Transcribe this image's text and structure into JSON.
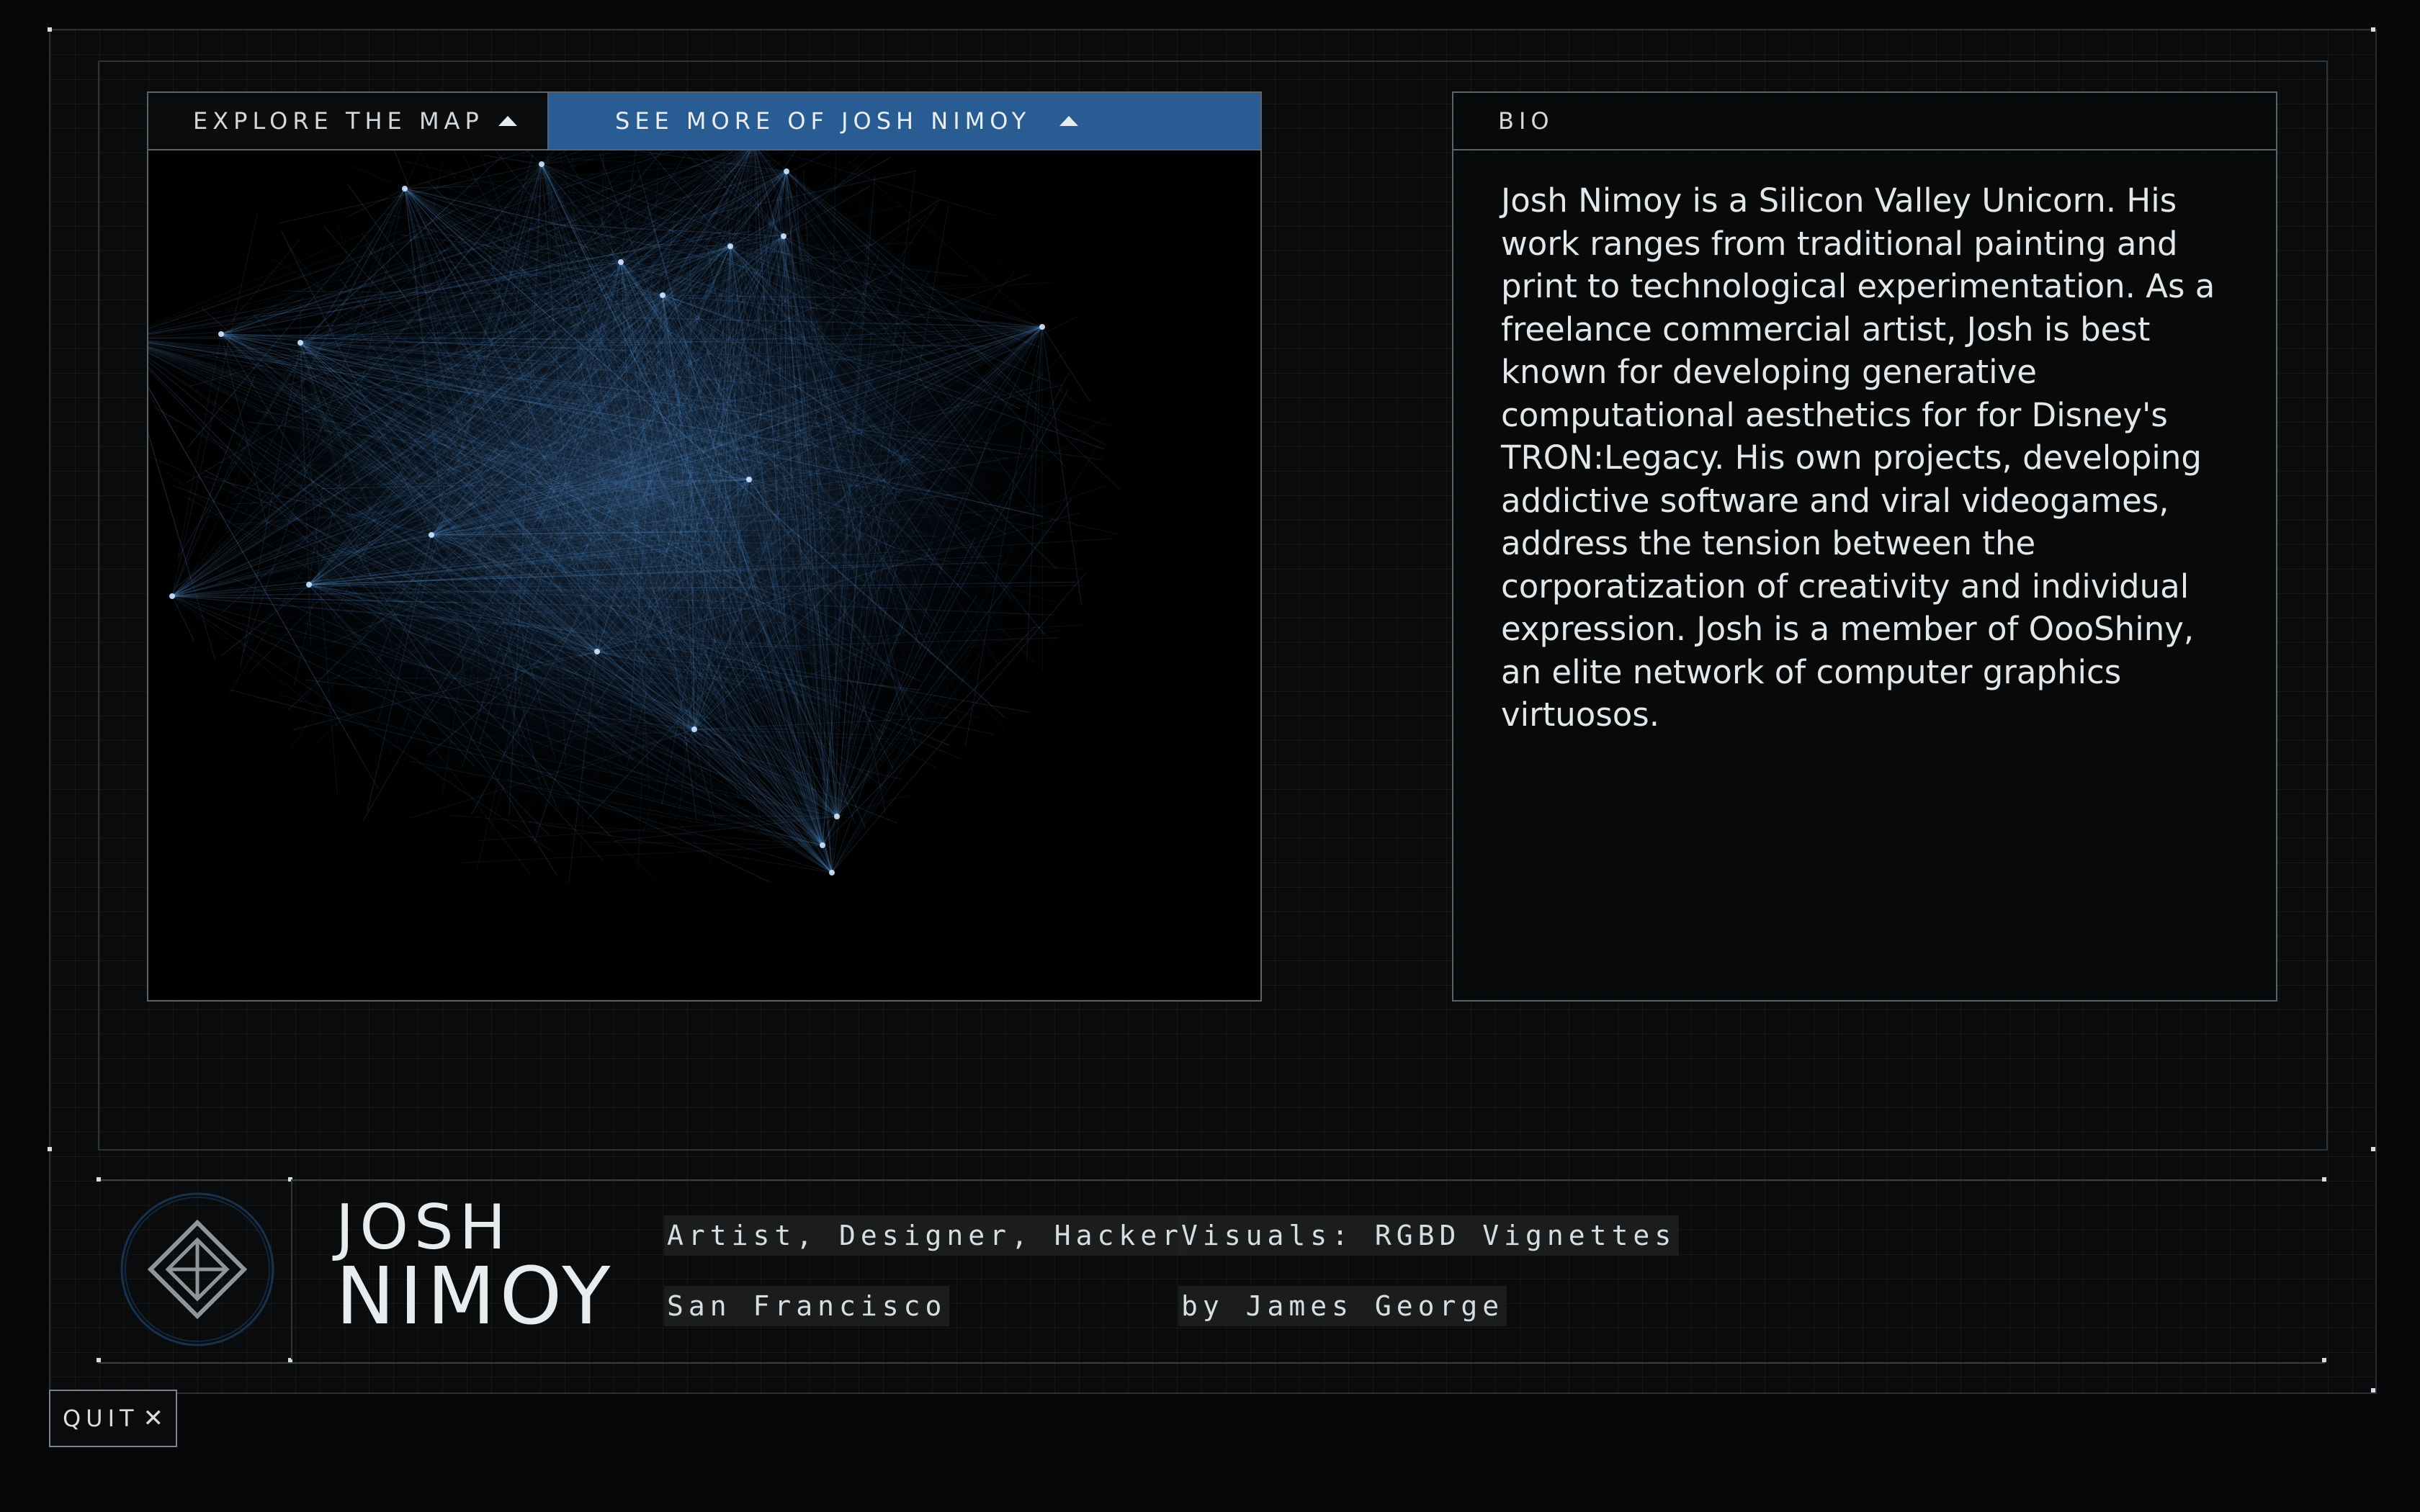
{
  "tabs": {
    "explore_label": "EXPLORE THE MAP",
    "see_more_label": "SEE MORE OF JOSH NIMOY"
  },
  "bio": {
    "header": "BIO",
    "lines": [
      "Josh Nimoy is a Silicon Valley Unicorn. His",
      "work ranges from traditional painting and",
      "print to technological experimentation. As a",
      "freelance commercial artist, Josh is best",
      "known for developing generative",
      "computational aesthetics for for Disney's",
      "TRON:Legacy. His own projects, developing",
      "addictive software and viral videogames,",
      "address the tension between the",
      "corporatization of creativity and individual",
      "expression. Josh is a member of OooShiny,",
      "an elite network of computer graphics",
      "virtuosos."
    ]
  },
  "profile": {
    "first_name": "JOSH",
    "last_name": "NIMOY",
    "roles": "Artist, Designer, Hacker",
    "location": "San Francisco",
    "visuals": "Visuals: RGBD Vignettes",
    "credit": "by James George"
  },
  "quit": {
    "label": "QUIT",
    "icon": "close-icon",
    "glyph": "✕"
  },
  "colors": {
    "accent": "#2a5c94",
    "network": "#5fa2e6",
    "background": "#050607"
  },
  "icons": {
    "logo": "diamond-logo-icon",
    "tab_arrow": "triangle-up-icon"
  }
}
